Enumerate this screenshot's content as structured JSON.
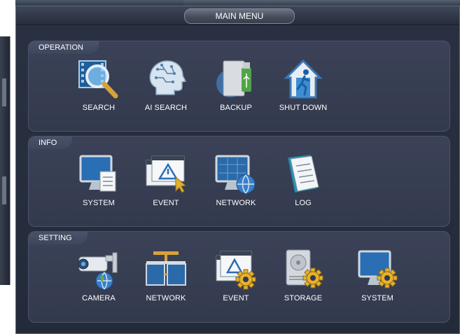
{
  "window": {
    "title": "MAIN MENU"
  },
  "sections": [
    {
      "title": "OPERATION",
      "items": [
        {
          "label": "SEARCH",
          "icon": "film-search-icon"
        },
        {
          "label": "AI SEARCH",
          "icon": "ai-head-icon"
        },
        {
          "label": "BACKUP",
          "icon": "usb-backup-icon"
        },
        {
          "label": "SHUT DOWN",
          "icon": "shutdown-house-icon"
        }
      ]
    },
    {
      "title": "INFO",
      "items": [
        {
          "label": "SYSTEM",
          "icon": "monitor-document-icon"
        },
        {
          "label": "EVENT",
          "icon": "warning-window-icon"
        },
        {
          "label": "NETWORK",
          "icon": "network-globe-icon"
        },
        {
          "label": "LOG",
          "icon": "log-book-icon"
        }
      ]
    },
    {
      "title": "SETTING",
      "items": [
        {
          "label": "CAMERA",
          "icon": "camera-globe-icon"
        },
        {
          "label": "NETWORK",
          "icon": "network-windows-icon"
        },
        {
          "label": "EVENT",
          "icon": "event-gear-icon"
        },
        {
          "label": "STORAGE",
          "icon": "storage-gear-icon"
        },
        {
          "label": "SYSTEM",
          "icon": "system-gear-icon"
        }
      ]
    }
  ]
}
